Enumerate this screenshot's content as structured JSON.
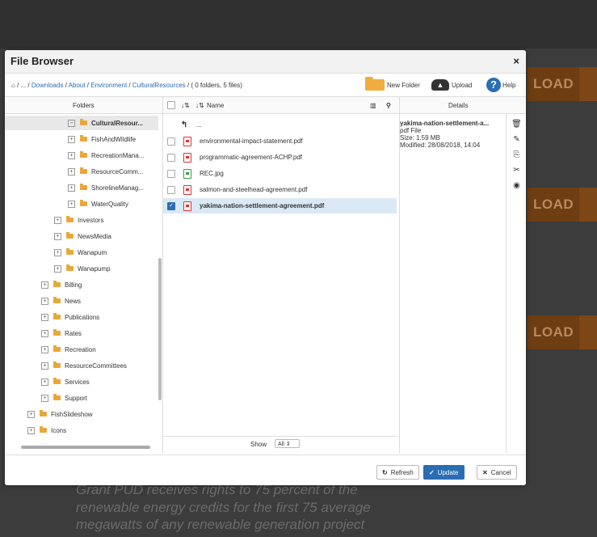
{
  "background": {
    "band_label": "LOAD",
    "text_lines": [
      "Grant PUD receives rights to 75 percent of the",
      "renewable energy credits for the first 75 average",
      "megawatts of any renewable generation project"
    ]
  },
  "modal": {
    "title": "File Browser",
    "close": "×"
  },
  "breadcrumb": {
    "home": "⌂",
    "sep1": " / ... / ",
    "items": [
      "Downloads",
      "About",
      "Environment",
      "CulturalResources"
    ],
    "summary": " / ( 0 folders, 5 files)"
  },
  "toolbar": {
    "new_folder": "New Folder",
    "upload": "Upload",
    "help": "Help",
    "help_icon": "?"
  },
  "panes": {
    "folders_header": "Folders",
    "name_header": "Name",
    "details_header": "Details"
  },
  "tree": [
    {
      "label": "CulturalResour...",
      "toggle": "−",
      "selected": true
    },
    {
      "label": "FishAndWildlife",
      "toggle": "+"
    },
    {
      "label": "RecreationMana...",
      "toggle": "+"
    },
    {
      "label": "ResourceComm...",
      "toggle": "+"
    },
    {
      "label": "ShorelineManag...",
      "toggle": "+"
    },
    {
      "label": "WaterQuality",
      "toggle": "+"
    },
    {
      "label": "Investors",
      "toggle": "+"
    },
    {
      "label": "NewsMedia",
      "toggle": "+"
    },
    {
      "label": "Wanapum",
      "toggle": "+"
    },
    {
      "label": "Wanapump",
      "toggle": "+"
    },
    {
      "label": "Billing",
      "toggle": "+"
    },
    {
      "label": "News",
      "toggle": "+"
    },
    {
      "label": "Publications",
      "toggle": "+"
    },
    {
      "label": "Rates",
      "toggle": "+"
    },
    {
      "label": "Recreation",
      "toggle": "+"
    },
    {
      "label": "ResourceCommittees",
      "toggle": "+"
    },
    {
      "label": "Services",
      "toggle": "+"
    },
    {
      "label": "Support",
      "toggle": "+"
    },
    {
      "label": "FishSlideshow",
      "toggle": "+"
    },
    {
      "label": "Icons",
      "toggle": "+"
    }
  ],
  "files": {
    "parent": "...",
    "items": [
      {
        "name": "environmental-impact-statement.pdf",
        "type": "pdf"
      },
      {
        "name": "programmatic-agreement-ACHP.pdf",
        "type": "pdf"
      },
      {
        "name": "REC.jpg",
        "type": "image"
      },
      {
        "name": "salmon-and-steelhead-agreement.pdf",
        "type": "pdf"
      },
      {
        "name": "yakima-nation-settlement-agreement.pdf",
        "type": "pdf",
        "selected": true
      }
    ],
    "show_label": "Show",
    "show_value": "All ⇕"
  },
  "details": {
    "name": "yakima-nation-settlement-a...",
    "type": "pdf File",
    "size": "Size: 1.59 MB",
    "modified": "Modified: 28/08/2018, 14:04"
  },
  "footer": {
    "refresh": "Refresh",
    "update": "Update",
    "cancel": "Cancel"
  },
  "colors": {
    "accent": "#2a6db3",
    "folder": "#e9a73a",
    "pdf": "#dd3333",
    "selection": "#dbe9f6"
  }
}
